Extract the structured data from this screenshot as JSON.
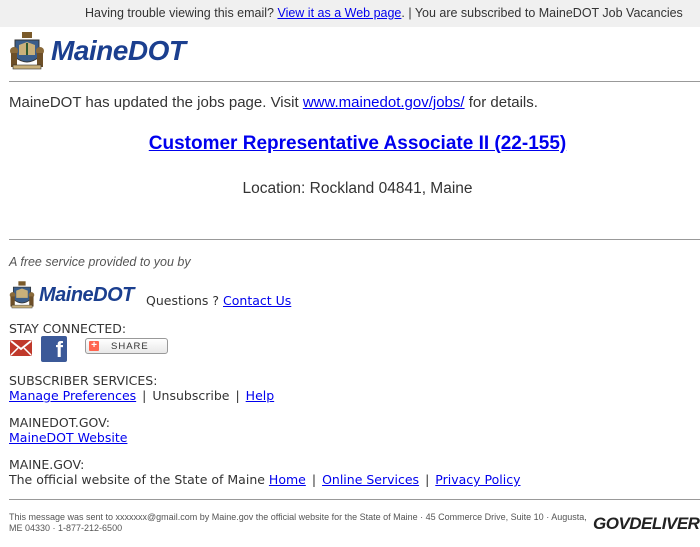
{
  "topbar": {
    "trouble_text": "Having trouble viewing this email?",
    "web_link": "View it as a Web page",
    "subscribed_text": ". | You are subscribed to MaineDOT Job Vacancies"
  },
  "header": {
    "logo_text": "MaineDOT"
  },
  "content": {
    "intro_text": "MaineDOT has updated the jobs page. Visit",
    "jobs_link": "www.mainedot.gov/jobs/",
    "intro_suffix": "for details.",
    "job_title": "Customer Representative Associate II (22-155)",
    "location": "Location: Rockland 04841, Maine"
  },
  "footer": {
    "free_service": "A free service provided to you by",
    "logo_text": "MaineDOT",
    "questions_text": "Questions ?",
    "contact_link": "Contact Us",
    "stay_connected": "STAY CONNECTED:",
    "share_label": "SHARE",
    "subscriber_services": "SUBSCRIBER SERVICES:",
    "manage_link": "Manage Preferences",
    "unsubscribe": "Unsubscribe",
    "help_link": "Help",
    "mainedot_gov": "MAINEDOT.GOV:",
    "mainedot_link": "MaineDOT Website",
    "maine_gov": "MAINE.GOV:",
    "official_text": "The official website of the State of Maine",
    "home_link": "Home",
    "online_link": "Online Services",
    "privacy_link": "Privacy Policy",
    "note": "This message was sent to xxxxxxx@gmail.com by Maine.gov the official website for the State of Maine · 45 Commerce Drive, Suite 10 · Augusta, ME 04330 · 1-877-212-6500",
    "govdelivery": "GOVDELIVERY"
  },
  "colors": {
    "brand": "#1b3f8f",
    "link": "#0000ee"
  }
}
